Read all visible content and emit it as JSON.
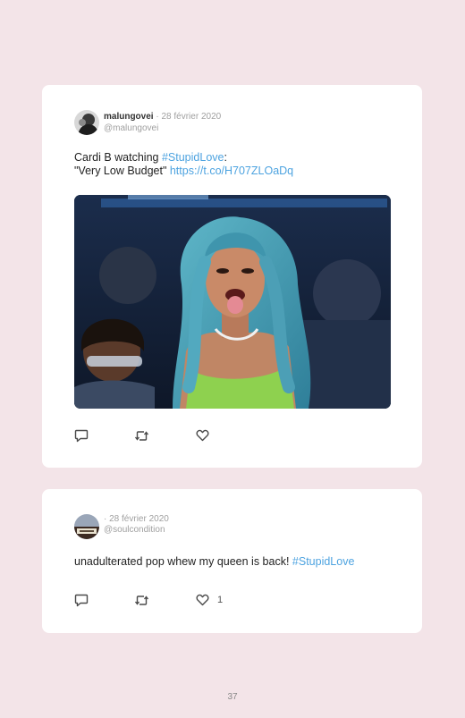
{
  "tweets": [
    {
      "author": "malungovei",
      "separator": "·",
      "date": "28 février 2020",
      "handle": "@malungovei",
      "text_line1_prefix": "Cardi B watching ",
      "text_line1_hashtag": "#StupidLove",
      "text_line1_suffix": ":",
      "text_line2_prefix": "\"Very Low Budget\" ",
      "text_line2_link": "https://t.co/H707ZLOaDq",
      "media_icon": "gif-image",
      "actions": {
        "reply_icon": "reply-icon",
        "retweet_icon": "retweet-icon",
        "like_icon": "heart-icon",
        "like_count": ""
      }
    },
    {
      "author": "",
      "separator": "·",
      "date": "28 février 2020",
      "handle": "@soulcondition",
      "text_prefix": "unadulterated pop whew my queen is back! ",
      "text_hashtag": "#StupidLove",
      "actions": {
        "reply_icon": "reply-icon",
        "retweet_icon": "retweet-icon",
        "like_icon": "heart-icon",
        "like_count": "1"
      }
    }
  ],
  "page": {
    "number": "37"
  },
  "colors": {
    "background": "#f3e4e8",
    "card": "#ffffff",
    "link": "#4da3e0",
    "muted": "#a0a0a0"
  }
}
